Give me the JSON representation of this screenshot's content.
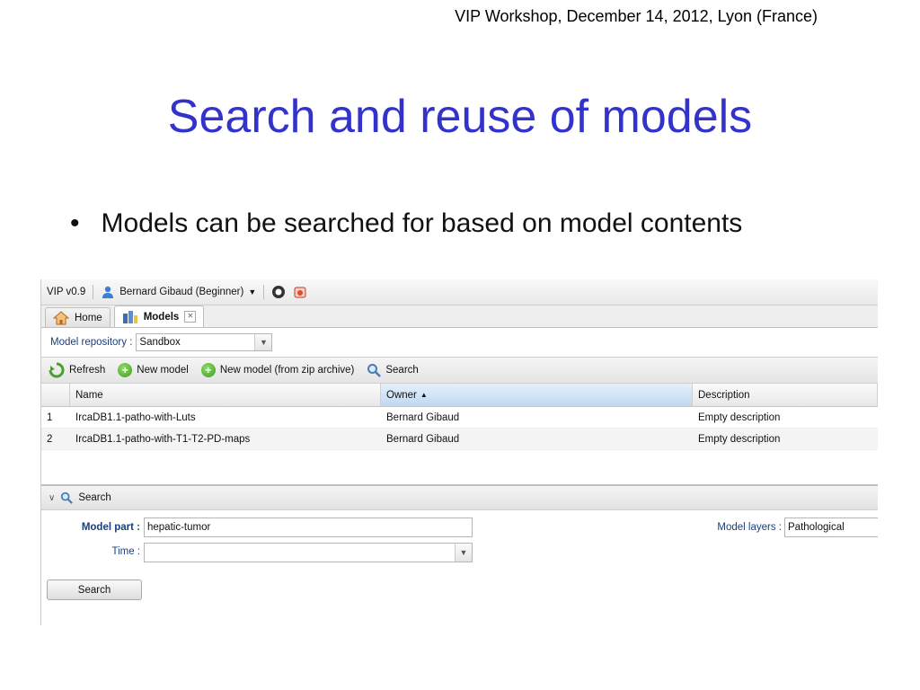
{
  "slide": {
    "header_line": "VIP Workshop, December 14, 2012, Lyon (France)",
    "title": "Search and reuse of models",
    "bullet": "Models can be searched for based on model contents"
  },
  "app": {
    "version": "VIP v0.9",
    "user": "Bernard Gibaud (Beginner)",
    "tabs": [
      {
        "label": "Home",
        "icon": "house-icon",
        "active": false
      },
      {
        "label": "Models",
        "icon": "models-icon",
        "active": true
      }
    ],
    "repository": {
      "label": "Model repository :",
      "value": "Sandbox"
    },
    "toolbar": {
      "refresh": "Refresh",
      "new_model": "New model",
      "new_model_zip": "New model (from zip archive)",
      "search": "Search"
    },
    "grid": {
      "columns": [
        "",
        "Name",
        "Owner",
        "Description"
      ],
      "sorted_column": "Owner",
      "rows": [
        {
          "index": "1",
          "name": "IrcaDB1.1-patho-with-Luts",
          "owner": "Bernard Gibaud",
          "description": "Empty description"
        },
        {
          "index": "2",
          "name": "IrcaDB1.1-patho-with-T1-T2-PD-maps",
          "owner": "Bernard Gibaud",
          "description": "Empty description"
        }
      ]
    },
    "search_panel": {
      "title": "Search",
      "model_part_label": "Model part :",
      "model_part_value": "hepatic-tumor",
      "time_label": "Time :",
      "time_value": "",
      "model_layers_label": "Model layers :",
      "model_layers_value": "Pathological",
      "search_button": "Search"
    },
    "colors": {
      "title_blue": "#3333cc",
      "label_blue": "#1a3e7a",
      "sorted_header": "#bfd8f2"
    }
  }
}
